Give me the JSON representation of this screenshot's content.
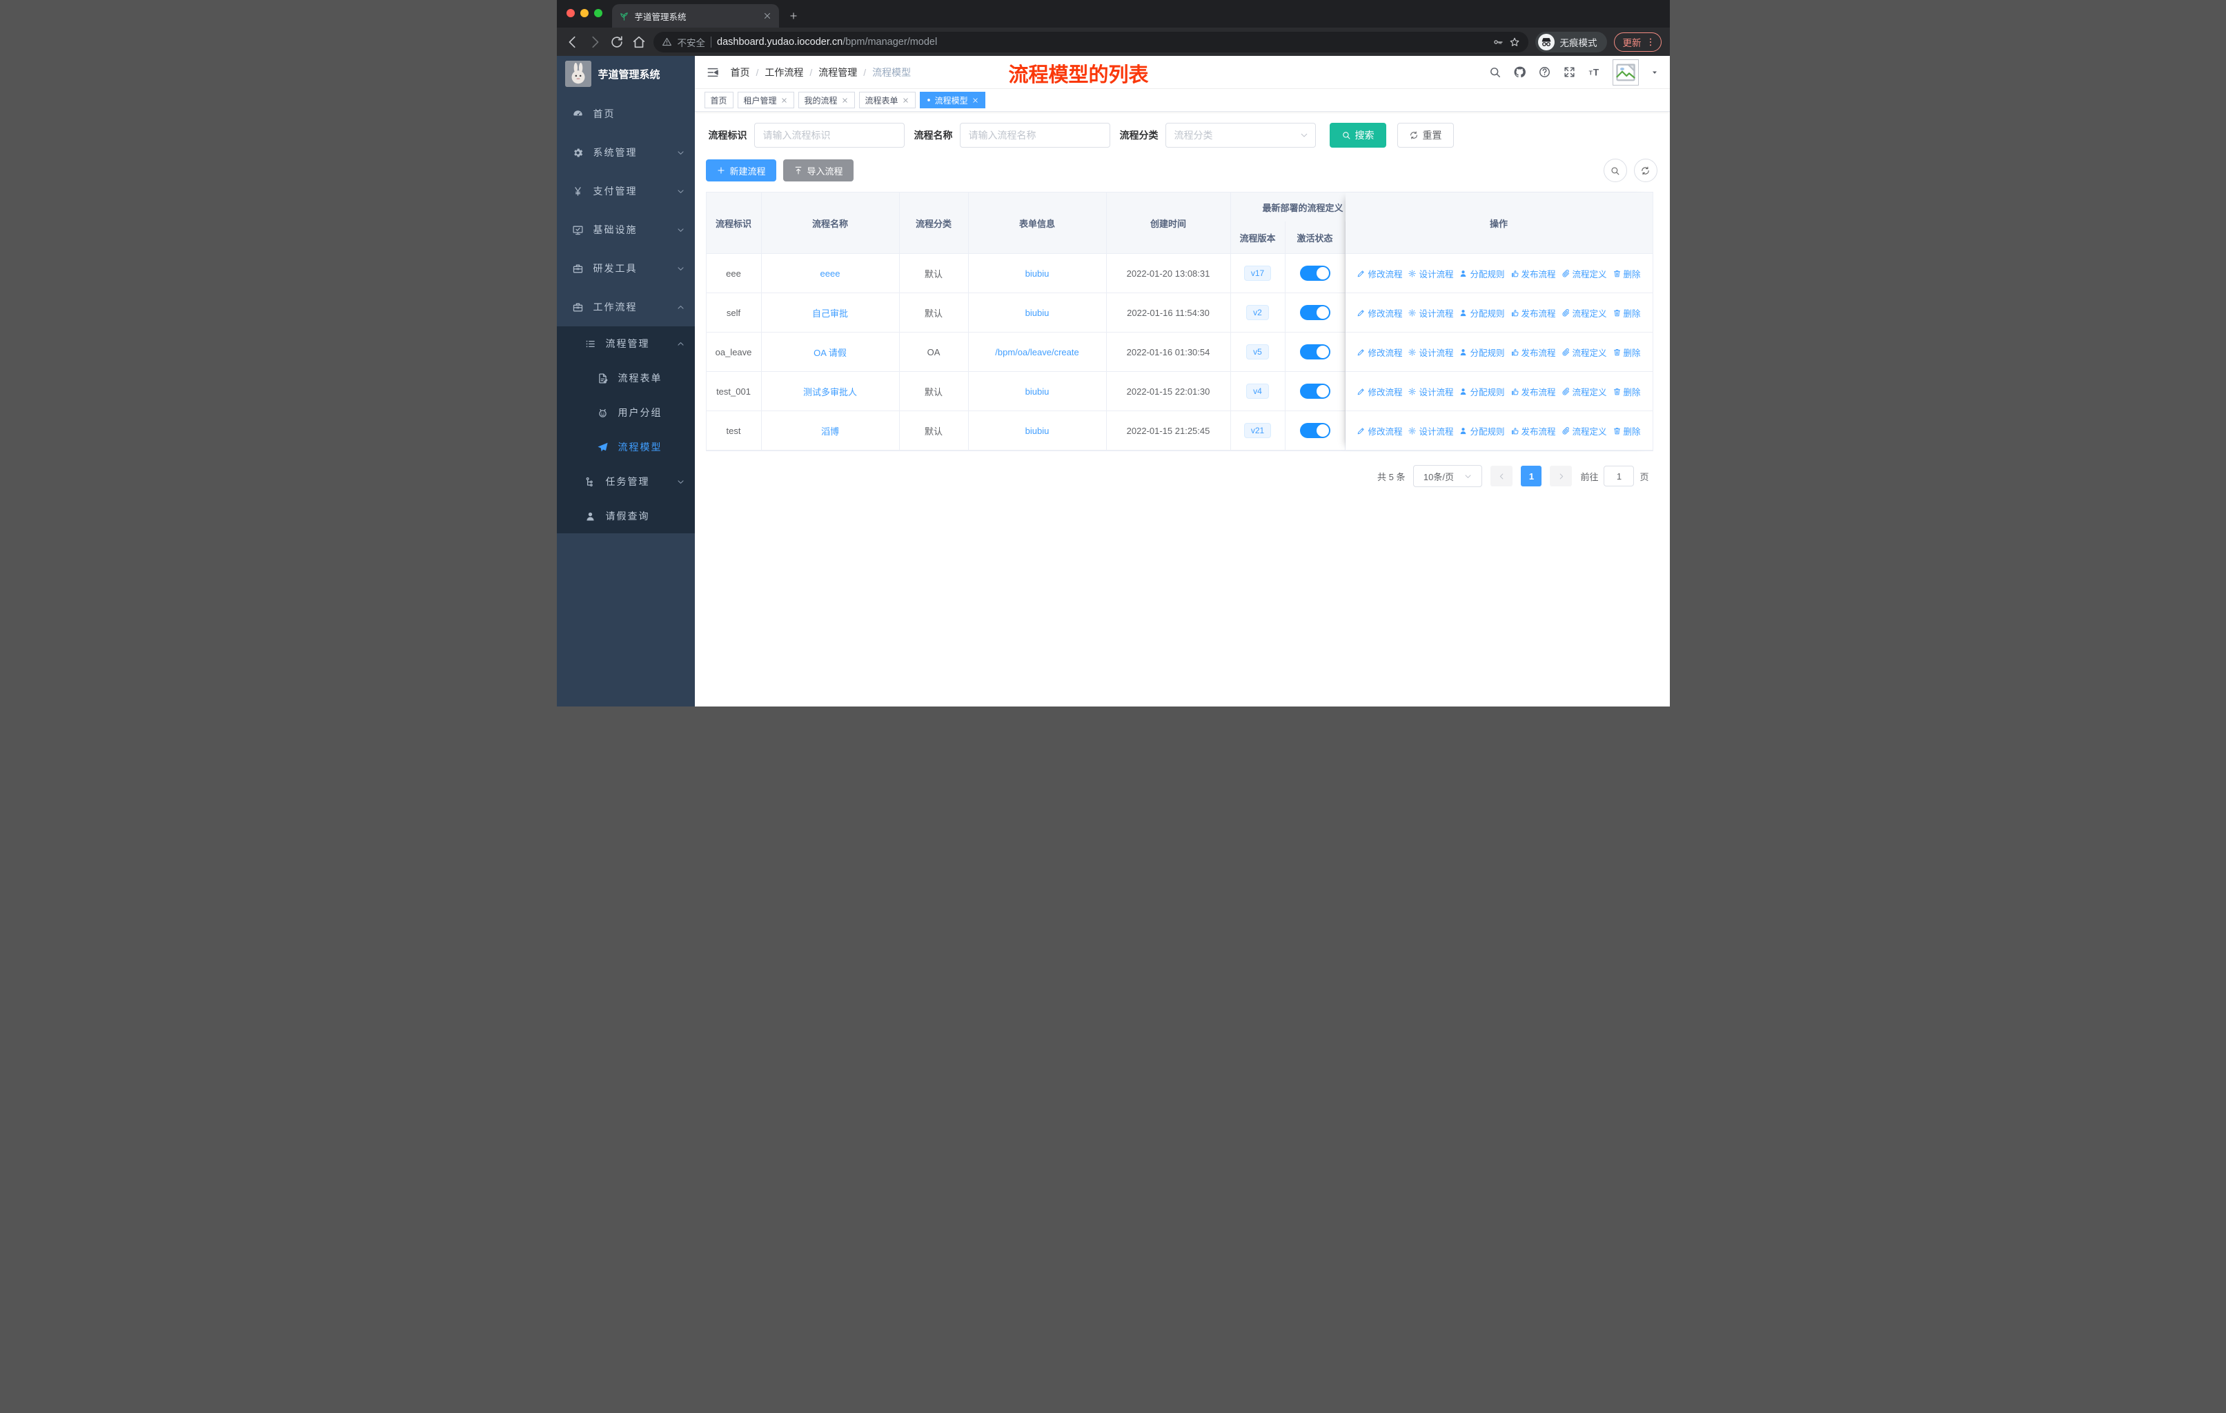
{
  "browser": {
    "tab_title": "芋道管理系统",
    "security_label": "不安全",
    "url_host": "dashboard.yudao.iocoder.cn",
    "url_path": "/bpm/manager/model",
    "incognito_label": "无痕模式",
    "update_label": "更新"
  },
  "sidebar": {
    "logo_title": "芋道管理系统",
    "top_items": [
      {
        "icon": "gauge-icon",
        "label": "首页",
        "chevron": ""
      },
      {
        "icon": "gear-icon",
        "label": "系统管理",
        "chevron": "down"
      },
      {
        "icon": "yen-icon",
        "label": "支付管理",
        "chevron": "down"
      },
      {
        "icon": "monitor-icon",
        "label": "基础设施",
        "chevron": "down"
      },
      {
        "icon": "briefcase-icon",
        "label": "研发工具",
        "chevron": "down"
      },
      {
        "icon": "briefcase-icon",
        "label": "工作流程",
        "chevron": "up"
      }
    ],
    "sub_items": [
      {
        "icon": "list-tree-icon",
        "label": "流程管理",
        "chevron": "up",
        "level": 1,
        "active": false
      },
      {
        "icon": "doc-edit-icon",
        "label": "流程表单",
        "chevron": "",
        "level": 2,
        "active": false
      },
      {
        "icon": "robot-icon",
        "label": "用户分组",
        "chevron": "",
        "level": 2,
        "active": false
      },
      {
        "icon": "plane-icon",
        "label": "流程模型",
        "chevron": "",
        "level": 2,
        "active": true
      },
      {
        "icon": "org-tree-icon",
        "label": "任务管理",
        "chevron": "down",
        "level": 1,
        "active": false
      },
      {
        "icon": "person-icon",
        "label": "请假查询",
        "chevron": "",
        "level": 1,
        "active": false
      }
    ]
  },
  "header": {
    "breadcrumb": [
      "首页",
      "工作流程",
      "流程管理",
      "流程模型"
    ],
    "annotation": "流程模型的列表",
    "right_icons": [
      "search-icon",
      "github-icon",
      "help-icon",
      "fullscreen-icon",
      "font-size-icon"
    ]
  },
  "tagbar": {
    "tags": [
      {
        "label": "首页",
        "closable": false,
        "active": false
      },
      {
        "label": "租户管理",
        "closable": true,
        "active": false
      },
      {
        "label": "我的流程",
        "closable": true,
        "active": false
      },
      {
        "label": "流程表单",
        "closable": true,
        "active": false
      },
      {
        "label": "流程模型",
        "closable": true,
        "active": true
      }
    ]
  },
  "filter": {
    "fields": [
      {
        "label": "流程标识",
        "placeholder": "请输入流程标识",
        "type": "input"
      },
      {
        "label": "流程名称",
        "placeholder": "请输入流程名称",
        "type": "input"
      },
      {
        "label": "流程分类",
        "placeholder": "流程分类",
        "type": "select"
      }
    ],
    "search_label": "搜索",
    "reset_label": "重置"
  },
  "toolbar": {
    "create_label": "新建流程",
    "import_label": "导入流程"
  },
  "table": {
    "columns": [
      "流程标识",
      "流程名称",
      "流程分类",
      "表单信息",
      "创建时间"
    ],
    "group_header": "最新部署的流程定义",
    "sub_columns": [
      "流程版本",
      "激活状态"
    ],
    "ops_header": "操作",
    "row_actions": [
      {
        "icon": "pen-icon",
        "label": "修改流程"
      },
      {
        "icon": "gear-line-icon",
        "label": "设计流程"
      },
      {
        "icon": "person-solid-icon",
        "label": "分配规则"
      },
      {
        "icon": "thumb-icon",
        "label": "发布流程"
      },
      {
        "icon": "paperclip-icon",
        "label": "流程定义"
      },
      {
        "icon": "trash-icon",
        "label": "删除"
      }
    ],
    "rows": [
      {
        "id": "eee",
        "name": "eeee",
        "category": "默认",
        "form": "biubiu",
        "created": "2022-01-20 13:08:31",
        "version": "v17",
        "active": true
      },
      {
        "id": "self",
        "name": "自己审批",
        "category": "默认",
        "form": "biubiu",
        "created": "2022-01-16 11:54:30",
        "version": "v2",
        "active": true
      },
      {
        "id": "oa_leave",
        "name": "OA 请假",
        "category": "OA",
        "form": "/bpm/oa/leave/create",
        "created": "2022-01-16 01:30:54",
        "version": "v5",
        "active": true
      },
      {
        "id": "test_001",
        "name": "测试多审批人",
        "category": "默认",
        "form": "biubiu",
        "created": "2022-01-15 22:01:30",
        "version": "v4",
        "active": true
      },
      {
        "id": "test",
        "name": "滔博",
        "category": "默认",
        "form": "biubiu",
        "created": "2022-01-15 21:25:45",
        "version": "v21",
        "active": true
      }
    ]
  },
  "pagination": {
    "total_text": "共 5 条",
    "page_size": "10条/页",
    "current_page": "1",
    "goto_prefix": "前往",
    "goto_value": "1",
    "goto_suffix": "页"
  },
  "colors": {
    "primary": "#409eff",
    "switch_on": "#1890ff",
    "search_button": "#1abc9c",
    "annotation_red": "#fa380a",
    "sidebar_bg": "#304156",
    "submenu_bg": "#1f2d3d",
    "tag_active": "#409eff"
  }
}
